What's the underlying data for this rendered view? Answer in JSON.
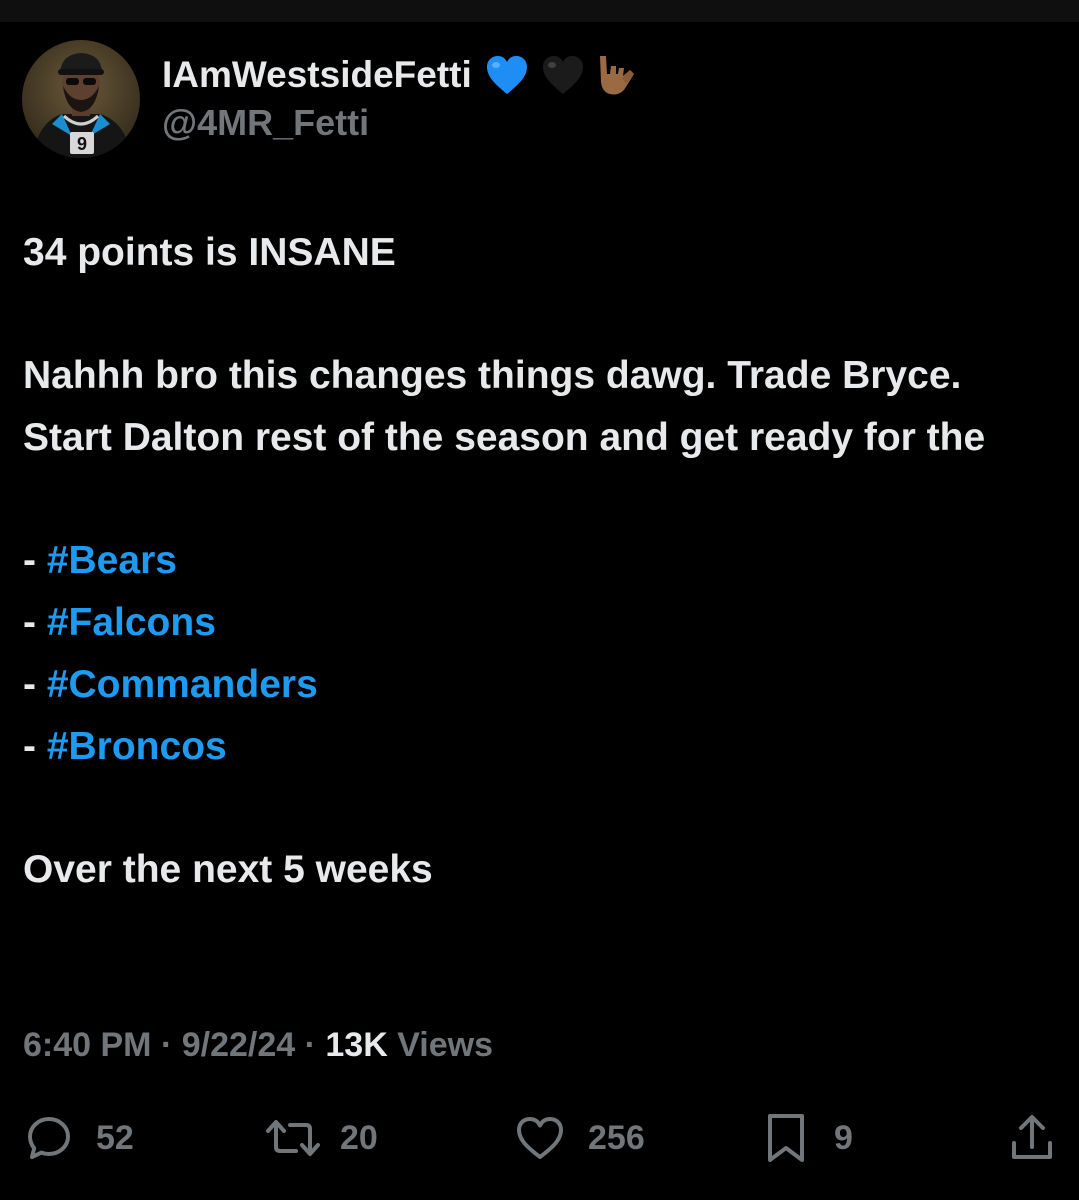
{
  "author": {
    "display_name": "IAmWestsideFetti",
    "handle": "@4MR_Fetti",
    "name_emojis": [
      "blue-heart",
      "black-heart",
      "love-you-gesture"
    ],
    "avatar_jersey_number": "9"
  },
  "tweet": {
    "line1": "34 points is INSANE",
    "paragraph2": "Nahhh bro this changes things dawg. Trade Bryce. Start Dalton rest of the season and get ready for the",
    "hashtags": [
      {
        "prefix": "- ",
        "tag": "#Bears"
      },
      {
        "prefix": "- ",
        "tag": "#Falcons"
      },
      {
        "prefix": "- ",
        "tag": "#Commanders"
      },
      {
        "prefix": "- ",
        "tag": "#Broncos"
      }
    ],
    "closing": "Over the next 5 weeks"
  },
  "meta": {
    "time": "6:40 PM",
    "separator": " · ",
    "date": "9/22/24",
    "views_count": "13K",
    "views_label": " Views"
  },
  "actions": {
    "replies": "52",
    "retweets": "20",
    "likes": "256",
    "bookmarks": "9"
  },
  "colors": {
    "background": "#000000",
    "text": "#e7e9ea",
    "secondary": "#71767b",
    "link": "#1d9bf0"
  }
}
